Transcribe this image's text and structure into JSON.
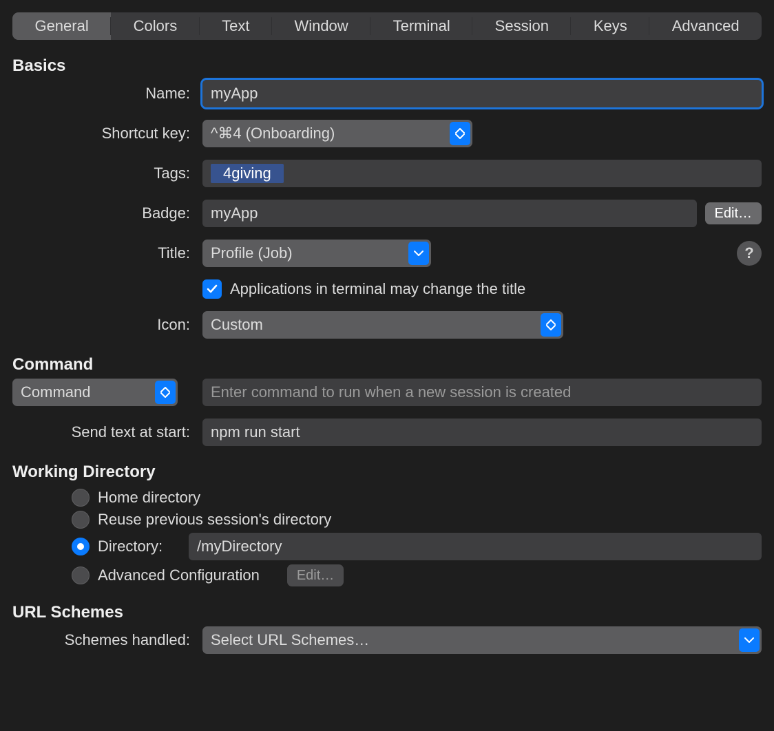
{
  "tabs": {
    "items": [
      "General",
      "Colors",
      "Text",
      "Window",
      "Terminal",
      "Session",
      "Keys",
      "Advanced"
    ],
    "active": 0
  },
  "sections": {
    "basics": "Basics",
    "command": "Command",
    "working_dir": "Working Directory",
    "url_schemes": "URL Schemes"
  },
  "basics": {
    "name_label": "Name:",
    "name_value": "myApp",
    "shortcut_label": "Shortcut key:",
    "shortcut_value": "^⌘4 (Onboarding)",
    "tags_label": "Tags:",
    "tag0": "4giving",
    "badge_label": "Badge:",
    "badge_value": "myApp",
    "badge_edit": "Edit…",
    "title_label": "Title:",
    "title_value": "Profile (Job)",
    "title_help": "?",
    "title_checkbox_label": "Applications in terminal may change the title",
    "icon_label": "Icon:",
    "icon_value": "Custom"
  },
  "command": {
    "mode_value": "Command",
    "command_placeholder": "Enter command to run when a new session is created",
    "send_text_label": "Send text at start:",
    "send_text_value": "npm run start"
  },
  "working_dir": {
    "opt_home": "Home directory",
    "opt_reuse": "Reuse previous session's directory",
    "opt_dir": "Directory:",
    "dir_value": "/myDirectory",
    "opt_adv": "Advanced Configuration",
    "adv_edit": "Edit…",
    "selected": "directory"
  },
  "url_schemes": {
    "label": "Schemes handled:",
    "value": "Select URL Schemes…"
  }
}
